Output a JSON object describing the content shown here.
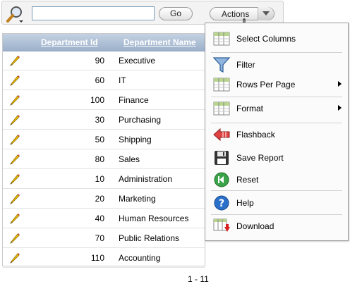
{
  "search": {
    "value": "",
    "placeholder": "",
    "go_label": "Go",
    "actions_label": "Actions"
  },
  "columns": {
    "id": "Department Id",
    "name": "Department Name"
  },
  "rows": [
    {
      "id": "90",
      "name": "Executive"
    },
    {
      "id": "60",
      "name": "IT"
    },
    {
      "id": "100",
      "name": "Finance"
    },
    {
      "id": "30",
      "name": "Purchasing"
    },
    {
      "id": "50",
      "name": "Shipping"
    },
    {
      "id": "80",
      "name": "Sales"
    },
    {
      "id": "10",
      "name": "Administration"
    },
    {
      "id": "20",
      "name": "Marketing"
    },
    {
      "id": "40",
      "name": "Human Resources"
    },
    {
      "id": "70",
      "name": "Public Relations"
    },
    {
      "id": "110",
      "name": "Accounting"
    }
  ],
  "pagination": "1 - 11",
  "menu": [
    {
      "label": "Select Columns",
      "icon": "grid-icon"
    },
    {
      "label": "Filter",
      "icon": "funnel-icon"
    },
    {
      "label": "Rows Per Page",
      "icon": "grid-icon",
      "submenu": true
    },
    {
      "label": "Format",
      "icon": "grid-icon",
      "submenu": true
    },
    {
      "label": "Flashback",
      "icon": "back-arrow-icon"
    },
    {
      "label": "Save Report",
      "icon": "floppy-icon"
    },
    {
      "label": "Reset",
      "icon": "reset-icon"
    },
    {
      "label": "Help",
      "icon": "help-icon"
    },
    {
      "label": "Download",
      "icon": "download-icon"
    }
  ],
  "colors": {
    "header_bg": "#9cb1cb",
    "header_text": "#ffffff",
    "accent_green": "#2e9e3e",
    "help_blue": "#2a6fc9"
  }
}
